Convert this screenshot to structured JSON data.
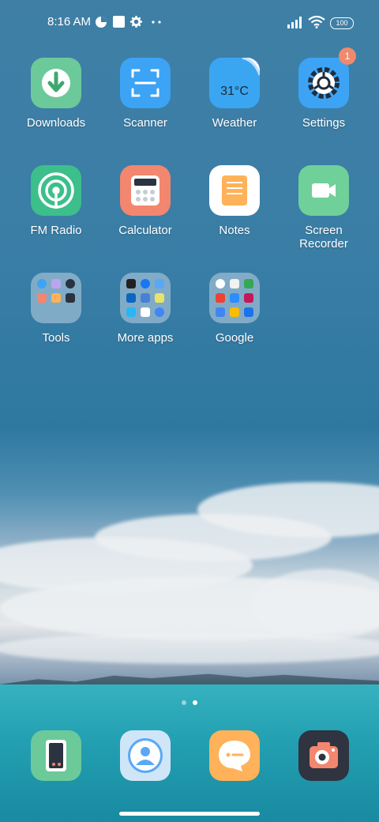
{
  "status_bar": {
    "time": "8:16 AM",
    "battery": "100"
  },
  "badge": {
    "settings_count": "1"
  },
  "apps": {
    "downloads": "Downloads",
    "scanner": "Scanner",
    "weather": "Weather",
    "weather_temp": "31°C",
    "settings": "Settings",
    "fm_radio": "FM Radio",
    "calculator": "Calculator",
    "notes": "Notes",
    "screen_recorder": "Screen\nRecorder",
    "tools": "Tools",
    "more_apps": "More apps",
    "google": "Google"
  },
  "colors": {
    "downloads": "#5fc58e",
    "scanner": "#3da3f5",
    "weather": "#3aa6f2",
    "settings": "#3da3f5",
    "fm_radio": "#3cbf8b",
    "calculator": "#f3866e",
    "notes": "#ffffff",
    "screen_recorder": "#5fd096",
    "dock_phone": "#5ec58a",
    "dock_contacts": "#a9d3f3",
    "dock_messages": "#ffb259",
    "dock_camera": "#2f3440"
  }
}
